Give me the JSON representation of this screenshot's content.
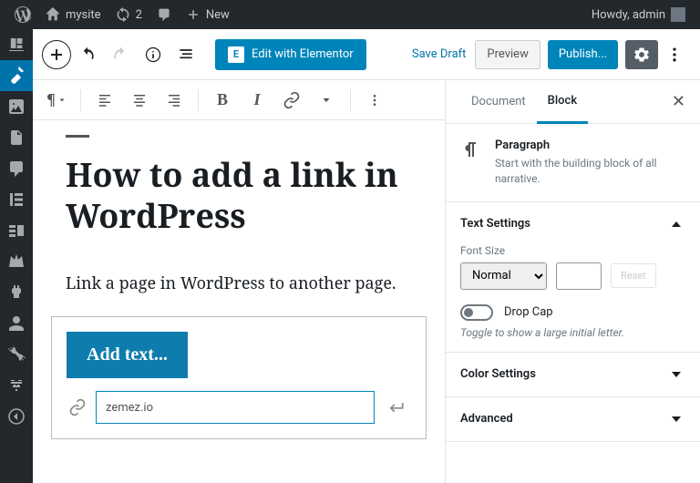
{
  "adminbar": {
    "sitename": "mysite",
    "updates": "2",
    "newlabel": "New",
    "howdy": "Howdy, admin"
  },
  "header": {
    "elementor": "Edit with Elementor",
    "savedraft": "Save Draft",
    "preview": "Preview",
    "publish": "Publish..."
  },
  "content": {
    "title": "How to add a link in WordPress",
    "para": "Link a page in WordPress to another page.",
    "addtext": "Add text...",
    "linkvalue": "zemez.io"
  },
  "sidebar": {
    "tabDocument": "Document",
    "tabBlock": "Block",
    "blockTitle": "Paragraph",
    "blockDesc": "Start with the building block of all narrative.",
    "textSettings": "Text Settings",
    "fontSize": "Font Size",
    "fontValue": "Normal",
    "reset": "Reset",
    "dropcap": "Drop Cap",
    "dropcapHelp": "Toggle to show a large initial letter.",
    "colorSettings": "Color Settings",
    "advanced": "Advanced"
  }
}
